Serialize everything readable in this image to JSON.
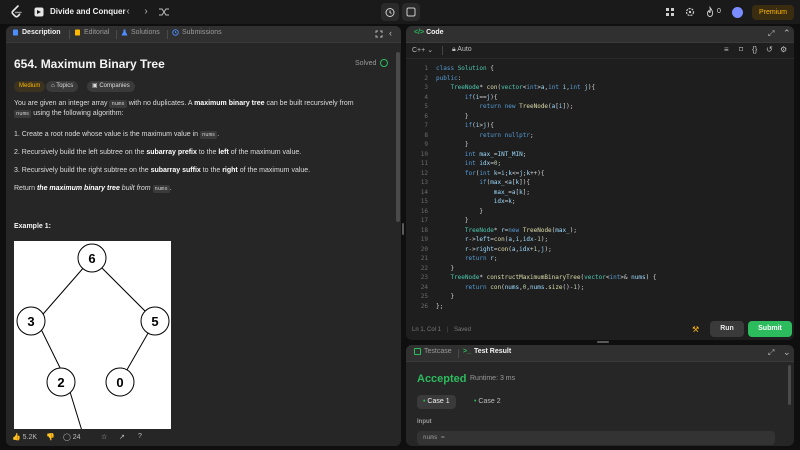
{
  "topbar": {
    "workspace_title": "Divide and Conquer",
    "fire_count": "0",
    "premium_label": "Premium"
  },
  "left_tabs": {
    "description": "Description",
    "editorial": "Editorial",
    "solutions": "Solutions",
    "submissions": "Submissions"
  },
  "problem": {
    "title": "654. Maximum Binary Tree",
    "status": "Solved",
    "difficulty": "Medium",
    "topics_label": "Topics",
    "companies_label": "Companies",
    "intro_1": "You are given an integer array",
    "intro_code": "nums",
    "intro_2": "with no duplicates. A",
    "intro_bold": "maximum binary tree",
    "intro_3": "can be built recursively from",
    "intro_code2": "nums",
    "intro_4": "using the following algorithm:",
    "step1_a": "1. Create a root node whose value is the maximum value in",
    "step1_code": "nums",
    "step1_b": ".",
    "step2_a": "2. Recursively build the left subtree on the",
    "step2_b1": "subarray prefix",
    "step2_c": "to the",
    "step2_b2": "left",
    "step2_d": "of the maximum value.",
    "step3_a": "3. Recursively build the right subtree on the",
    "step3_b1": "subarray suffix",
    "step3_c": "to the",
    "step3_b2": "right",
    "step3_d": "of the maximum value.",
    "return_a": "Return",
    "return_b": "the maximum binary tree",
    "return_c": "built from",
    "return_code": "nums",
    "return_d": ".",
    "example_title": "Example 1:",
    "tree_nodes": [
      "6",
      "3",
      "5",
      "2",
      "0"
    ]
  },
  "left_footer": {
    "likes": "5.2K",
    "comments": "24"
  },
  "code_panel": {
    "title": "Code",
    "language": "C++",
    "mode": "Auto",
    "cursor": "Ln 1, Col 1",
    "saved": "Saved",
    "run_label": "Run",
    "submit_label": "Submit",
    "line_numbers": [
      "1",
      "2",
      "3",
      "4",
      "5",
      "6",
      "7",
      "8",
      "9",
      "10",
      "11",
      "12",
      "13",
      "14",
      "15",
      "16",
      "17",
      "18",
      "19",
      "20",
      "21",
      "22",
      "23",
      "24",
      "25",
      "26"
    ]
  },
  "test_panel": {
    "testcase_tab": "Testcase",
    "result_tab": "Test Result",
    "verdict": "Accepted",
    "runtime": "Runtime: 3 ms",
    "case1": "Case 1",
    "case2": "Case 2",
    "input_label": "Input",
    "input_value": "nums ="
  },
  "colors": {
    "accent_green": "#2cbb5d",
    "premium_gold": "#ffb800",
    "medium_badge": "#ffb800"
  }
}
